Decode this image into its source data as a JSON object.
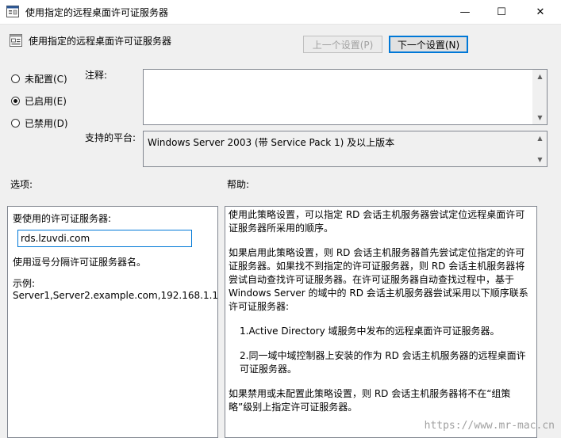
{
  "window": {
    "title": "使用指定的远程桌面许可证服务器",
    "minimize_glyph": "—",
    "maximize_glyph": "☐",
    "close_glyph": "✕"
  },
  "header": {
    "policy_name": "使用指定的远程桌面许可证服务器",
    "prev_button": "上一个设置(P)",
    "next_button": "下一个设置(N)"
  },
  "state": {
    "options": [
      {
        "label": "未配置(C)",
        "checked": false
      },
      {
        "label": "已启用(E)",
        "checked": true
      },
      {
        "label": "已禁用(D)",
        "checked": false
      }
    ]
  },
  "comment": {
    "label": "注释:",
    "value": ""
  },
  "platform": {
    "label": "支持的平台:",
    "value": "Windows Server 2003 (带 Service Pack 1) 及以上版本"
  },
  "options_section": {
    "heading": "选项:",
    "field_label": "要使用的许可证服务器:",
    "field_value": "rds.lzuvdi.com",
    "hint": "使用逗号分隔许可证服务器名。",
    "example_label": "示例:",
    "example_value": "Server1,Server2.example.com,192.168.1.1"
  },
  "help_section": {
    "heading": "帮助:",
    "paragraphs": [
      "使用此策略设置，可以指定 RD 会话主机服务器尝试定位远程桌面许可证服务器所采用的顺序。",
      "如果启用此策略设置，则 RD 会话主机服务器首先尝试定位指定的许可证服务器。如果找不到指定的许可证服务器，则 RD 会话主机服务器将尝试自动查找许可证服务器。在许可证服务器自动查找过程中，基于 Windows Server 的域中的 RD 会话主机服务器尝试采用以下顺序联系许可证服务器:",
      "1.Active Directory 域服务中发布的远程桌面许可证服务器。",
      "2.同一域中域控制器上安装的作为 RD 会话主机服务器的远程桌面许可证服务器。",
      "如果禁用或未配置此策略设置，则 RD 会话主机服务器将不在“组策略”级别上指定许可证服务器。"
    ]
  },
  "watermark": "https://www.mr-mac.cn"
}
